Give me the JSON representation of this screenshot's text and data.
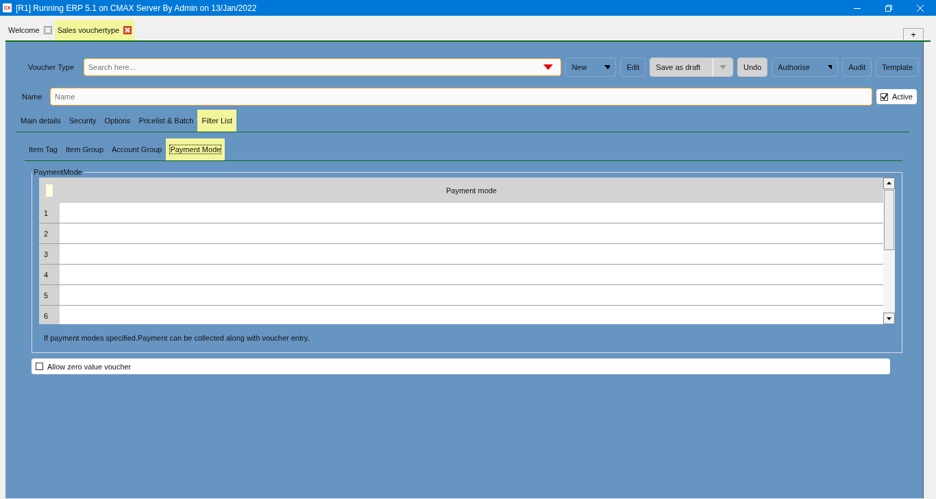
{
  "window": {
    "app_icon": "CX",
    "title": "[R1] Running ERP 5.1 on CMAX Server By Admin on 13/Jan/2022"
  },
  "doc_tabs": [
    {
      "label": "Welcome",
      "selected": false
    },
    {
      "label": "Sales vouchertype",
      "selected": true
    }
  ],
  "add_tab": "+",
  "toolbar": {
    "label": "Voucher Type",
    "search_placeholder": "Search here...",
    "buttons": [
      {
        "label": "New",
        "kind": "dropdown",
        "shaded": false
      },
      {
        "label": "Edit",
        "kind": "plain",
        "shaded": false
      },
      {
        "label": "Save as draft",
        "kind": "split",
        "shaded": true
      },
      {
        "label": "Undo",
        "kind": "plain",
        "shaded": true
      },
      {
        "label": "Authorise",
        "kind": "dropdown",
        "shaded": false
      },
      {
        "label": "Audit",
        "kind": "plain",
        "shaded": false
      },
      {
        "label": "Template",
        "kind": "plain",
        "shaded": false
      }
    ]
  },
  "name_field": {
    "label": "Name",
    "placeholder": "Name"
  },
  "active": {
    "label": "Active",
    "checked": true
  },
  "tabs": [
    {
      "label": "Main details",
      "selected": false
    },
    {
      "label": "Security",
      "selected": false
    },
    {
      "label": "Options",
      "selected": false
    },
    {
      "label": "Pricelist & Batch",
      "selected": false
    },
    {
      "label": "Filter List",
      "selected": true
    }
  ],
  "sub_tabs": [
    {
      "label": "Item Tag",
      "selected": false
    },
    {
      "label": "Item Group",
      "selected": false
    },
    {
      "label": "Account Group",
      "selected": false
    },
    {
      "label": "Payment Mode",
      "selected": true
    }
  ],
  "group": {
    "title": "PaymentMode",
    "column": "Payment mode",
    "rows": [
      "1",
      "2",
      "3",
      "4",
      "5",
      "6"
    ],
    "note": "If payment modes specified.Payment can be collected along with voucher entry."
  },
  "allow_zero": {
    "label": "Allow zero value voucher",
    "checked": false
  }
}
